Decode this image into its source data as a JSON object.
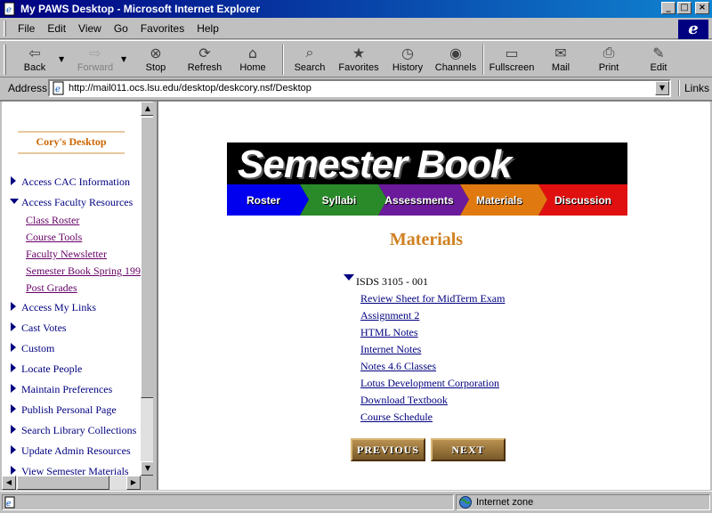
{
  "window": {
    "title": "My PAWS Desktop - Microsoft Internet Explorer",
    "min": "_",
    "max": "□",
    "close": "×"
  },
  "menu": [
    "File",
    "Edit",
    "View",
    "Go",
    "Favorites",
    "Help"
  ],
  "toolbar": {
    "back": "Back",
    "forward": "Forward",
    "stop": "Stop",
    "refresh": "Refresh",
    "home": "Home",
    "search": "Search",
    "favorites": "Favorites",
    "history": "History",
    "channels": "Channels",
    "fullscreen": "Fullscreen",
    "mail": "Mail",
    "print": "Print",
    "edit": "Edit"
  },
  "address": {
    "label": "Address",
    "url": "http://mail011.ocs.lsu.edu/desktop/deskcory.nsf/Desktop",
    "links": "Links"
  },
  "sidebar": {
    "title": "Cory's Desktop",
    "items": [
      {
        "label": "Access CAC Information",
        "expanded": false
      },
      {
        "label": "Access Faculty Resources",
        "expanded": true
      },
      {
        "label": "Access My Links",
        "expanded": false
      },
      {
        "label": "Cast Votes",
        "expanded": false
      },
      {
        "label": "Custom",
        "expanded": false
      },
      {
        "label": "Locate People",
        "expanded": false
      },
      {
        "label": "Maintain Preferences",
        "expanded": false
      },
      {
        "label": "Publish Personal Page",
        "expanded": false
      },
      {
        "label": "Search Library Collections",
        "expanded": false
      },
      {
        "label": "Update Admin Resources",
        "expanded": false
      },
      {
        "label": "View Semester Materials",
        "expanded": false
      }
    ],
    "subitems": [
      "Class Roster",
      "Course Tools",
      "Faculty Newsletter",
      "Semester Book Spring 199",
      "Post Grades"
    ]
  },
  "banner": {
    "title": "Semester Book",
    "tabs": [
      {
        "label": "Roster",
        "color": "#0000ee"
      },
      {
        "label": "Syllabi",
        "color": "#2a8a2a"
      },
      {
        "label": "Assessments",
        "color": "#6a1a9a"
      },
      {
        "label": "Materials",
        "color": "#e07a10"
      },
      {
        "label": "Discussion",
        "color": "#e01010"
      }
    ]
  },
  "main": {
    "heading": "Materials",
    "course": "ISDS 3105 - 001",
    "links": [
      "Review Sheet for MidTerm Exam",
      "Assignment 2",
      "HTML Notes",
      "Internet Notes",
      "Notes 4.6 Classes",
      "Lotus Development Corporation",
      "Download Textbook",
      "Course Schedule"
    ],
    "prev": "PREVIOUS",
    "next": "NEXT"
  },
  "status": {
    "text": "",
    "zone": "Internet zone"
  }
}
